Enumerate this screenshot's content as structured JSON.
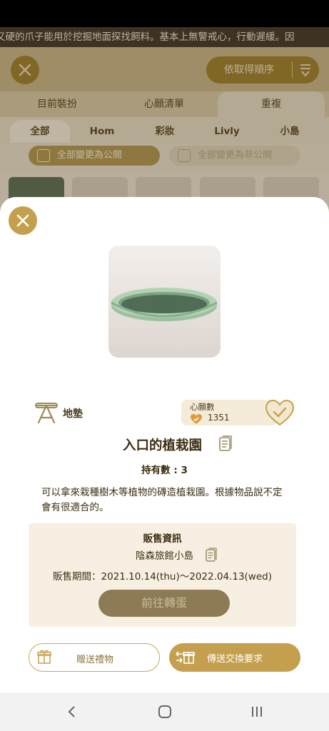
{
  "background": {
    "marquee_text": "又硬的爪子能用於挖掘地面探找飼料。基本上無警戒心，行動遲緩。因",
    "sort_label": "依取得順序",
    "tabs": [
      {
        "label": "目前裝扮"
      },
      {
        "label": "心願清單"
      },
      {
        "label": "重複"
      }
    ],
    "subtabs": [
      {
        "label": "全部"
      },
      {
        "label": "Hom"
      },
      {
        "label": "彩妝"
      },
      {
        "label": "Livly"
      },
      {
        "label": "小島"
      }
    ],
    "make_public_label": "全部變更為公開",
    "make_private_label": "全部變更為非公開"
  },
  "item": {
    "category_icon": "rug-stand-icon",
    "category": "地墊",
    "wishlist_label": "心願數",
    "wishlist_count": "1351",
    "name": "入口的植栽園",
    "owned": "持有數 : 3",
    "description": "可以拿來栽種樹木等植物的磚造植栽園。根據物品說不定會有很適合的。"
  },
  "sale": {
    "heading": "販售資訊",
    "location": "陰森旅館小島",
    "period": "販售期間：2021.10.14(thu)～2022.04.13(wed)",
    "gacha_button": "前往轉蛋"
  },
  "actions": {
    "gift_label": "贈送禮物",
    "trade_label": "傳送交換要求"
  },
  "colors": {
    "accent_gold": "#c4a04e",
    "dark_gold": "#a0802f",
    "text_brown": "#3d2e12"
  }
}
